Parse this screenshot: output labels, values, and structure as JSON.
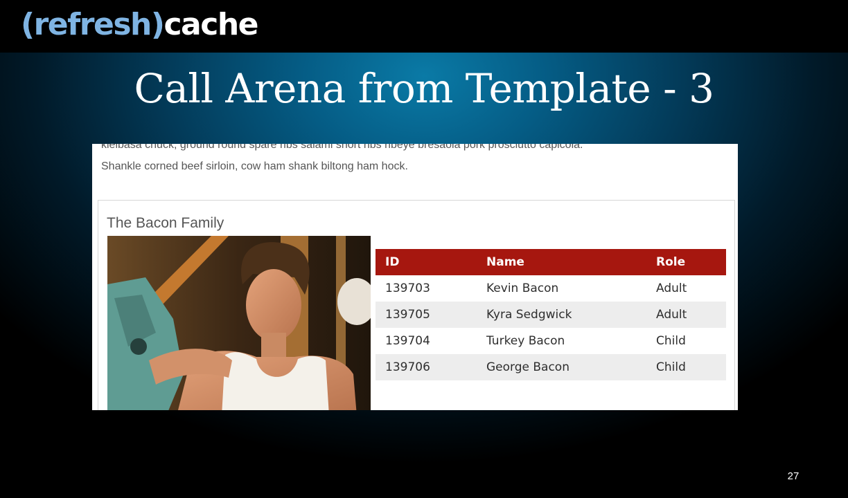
{
  "logo": {
    "paren_text": "(refresh)",
    "cache_text": "cache"
  },
  "slide": {
    "title": "Call Arena from Template - 3",
    "page_number": "27"
  },
  "screenshot": {
    "lorem_line1": "kielbasa chuck, ground round spare ribs salami short ribs ribeye bresaola pork prosciutto capicola.",
    "lorem_line2": "Shankle corned beef sirloin, cow ham shank biltong ham hock.",
    "panel_title": "The Bacon Family",
    "photo_icon": "person-photo",
    "table": {
      "headers": [
        "ID",
        "Name",
        "Role"
      ],
      "rows": [
        [
          "139703",
          "Kevin Bacon",
          "Adult"
        ],
        [
          "139705",
          "Kyra Sedgwick",
          "Adult"
        ],
        [
          "139704",
          "Turkey Bacon",
          "Child"
        ],
        [
          "139706",
          "George Bacon",
          "Child"
        ]
      ],
      "header_color": "#a6170f",
      "alt_row_color": "#ededed"
    }
  }
}
